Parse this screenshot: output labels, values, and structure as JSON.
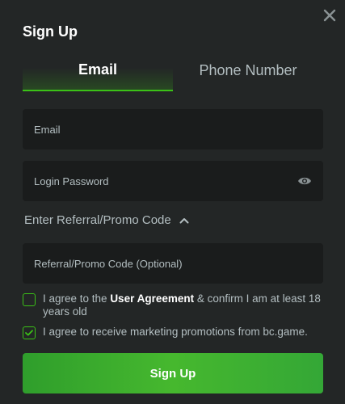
{
  "modal": {
    "title": "Sign Up"
  },
  "tabs": [
    {
      "label": "Email",
      "active": true
    },
    {
      "label": "Phone Number",
      "active": false
    }
  ],
  "form": {
    "email_placeholder": "Email",
    "password_placeholder": "Login Password",
    "referral_toggle_label": "Enter Referral/Promo Code",
    "referral_placeholder": "Referral/Promo Code (Optional)"
  },
  "agreement": {
    "prefix": "I agree to the ",
    "link": "User Agreement",
    "suffix": " & confirm I am at least 18 years old",
    "checked": false
  },
  "marketing": {
    "text": "I agree to receive marketing promotions from bc.game.",
    "checked": true
  },
  "submit_label": "Sign Up",
  "colors": {
    "background": "#232626",
    "input_bg": "#1a1c1c",
    "accent": "#3bc117",
    "muted_text": "#b3bec1"
  },
  "icons": {
    "close": "close-icon",
    "eye": "eye-icon",
    "chevron": "chevron-up-icon",
    "check": "check-icon"
  }
}
